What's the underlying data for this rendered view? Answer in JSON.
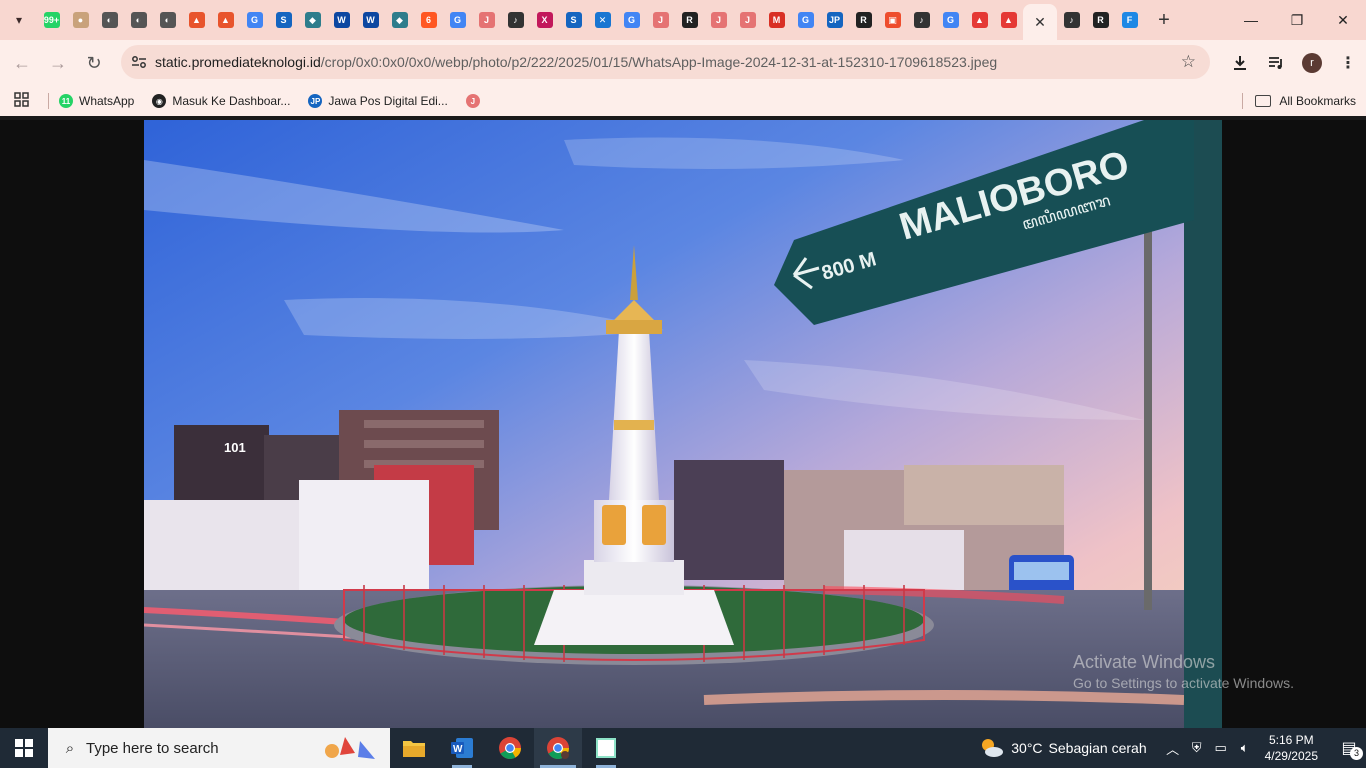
{
  "browser": {
    "tabs": [
      {
        "icon": "whatsapp-icon",
        "color": "#25d366",
        "glyph": "99+"
      },
      {
        "icon": "site-icon",
        "color": "#c9a27b",
        "glyph": "●"
      },
      {
        "icon": "globe-icon",
        "color": "#555555",
        "glyph": "◐"
      },
      {
        "icon": "globe-icon",
        "color": "#555555",
        "glyph": "◐"
      },
      {
        "icon": "globe-icon",
        "color": "#555555",
        "glyph": "◐"
      },
      {
        "icon": "fire-icon",
        "color": "#e8542c",
        "glyph": "▲"
      },
      {
        "icon": "fire-icon",
        "color": "#e8542c",
        "glyph": "▲"
      },
      {
        "icon": "google-icon",
        "color": "#4285f4",
        "glyph": "G"
      },
      {
        "icon": "site-icon",
        "color": "#1565c0",
        "glyph": "S"
      },
      {
        "icon": "shield-icon",
        "color": "#2e7d8c",
        "glyph": "◆"
      },
      {
        "icon": "site-icon",
        "color": "#0d47a1",
        "glyph": "W"
      },
      {
        "icon": "site-icon",
        "color": "#0d47a1",
        "glyph": "W"
      },
      {
        "icon": "shield-icon",
        "color": "#2e7d8c",
        "glyph": "◆"
      },
      {
        "icon": "site-icon",
        "color": "#ff5722",
        "glyph": "6"
      },
      {
        "icon": "google-icon",
        "color": "#4285f4",
        "glyph": "G"
      },
      {
        "icon": "jpr-icon",
        "color": "#e57373",
        "glyph": "J"
      },
      {
        "icon": "audio-icon",
        "color": "#333333",
        "glyph": "♪"
      },
      {
        "icon": "site-icon",
        "color": "#c2185b",
        "glyph": "X"
      },
      {
        "icon": "site-icon",
        "color": "#1565c0",
        "glyph": "S"
      },
      {
        "icon": "site-icon",
        "color": "#1976d2",
        "glyph": "✕"
      },
      {
        "icon": "google-icon",
        "color": "#4285f4",
        "glyph": "G"
      },
      {
        "icon": "jpr-icon",
        "color": "#e57373",
        "glyph": "J"
      },
      {
        "icon": "site-icon",
        "color": "#222222",
        "glyph": "R"
      },
      {
        "icon": "jpr-icon",
        "color": "#e57373",
        "glyph": "J"
      },
      {
        "icon": "jpr-icon",
        "color": "#e57373",
        "glyph": "J"
      },
      {
        "icon": "gmail-icon",
        "color": "#d93025",
        "glyph": "M"
      },
      {
        "icon": "google-icon",
        "color": "#4285f4",
        "glyph": "G"
      },
      {
        "icon": "jp-icon",
        "color": "#1565c0",
        "glyph": "JP"
      },
      {
        "icon": "site-icon",
        "color": "#222222",
        "glyph": "R"
      },
      {
        "icon": "shopping-icon",
        "color": "#ee4d2d",
        "glyph": "▣"
      },
      {
        "icon": "audio-icon",
        "color": "#333333",
        "glyph": "♪"
      },
      {
        "icon": "google-icon",
        "color": "#4285f4",
        "glyph": "G"
      },
      {
        "icon": "site-icon",
        "color": "#e53935",
        "glyph": "▲"
      },
      {
        "icon": "site-icon",
        "color": "#e53935",
        "glyph": "▲"
      }
    ],
    "after_tabs": [
      {
        "icon": "audio-icon",
        "color": "#333333",
        "glyph": "♪"
      },
      {
        "icon": "site-icon",
        "color": "#222222",
        "glyph": "R"
      },
      {
        "icon": "forms-icon",
        "color": "#1e88e5",
        "glyph": "F"
      }
    ],
    "url_host": "static.promediateknologi.id",
    "url_path": "/crop/0x0:0x0/0x0/webp/photo/p2/222/2025/01/15/WhatsApp-Image-2024-12-31-at-152310-1709618523.jpeg",
    "profile_initial": "r"
  },
  "bookmarks": {
    "items": [
      {
        "label": "WhatsApp",
        "icon": "whatsapp-icon",
        "color": "#25d366",
        "glyph": "11"
      },
      {
        "label": "Masuk Ke Dashboar...",
        "icon": "github-icon",
        "color": "#222222",
        "glyph": "◉"
      },
      {
        "label": "Jawa Pos Digital Edi...",
        "icon": "jp-icon",
        "color": "#1565c0",
        "glyph": "JP"
      },
      {
        "label": "",
        "icon": "jpr-icon",
        "color": "#e57373",
        "glyph": "J"
      }
    ],
    "all_label": "All Bookmarks"
  },
  "photo": {
    "sign_main": "MALIOBORO",
    "sign_distance": "800 M",
    "sign_script": "ꦩꦭꦶꦪꦧꦫ",
    "hotel_text": "101"
  },
  "watermark": {
    "title": "Activate Windows",
    "subtitle": "Go to Settings to activate Windows."
  },
  "taskbar": {
    "search_placeholder": "Type here to search",
    "weather_temp": "30°C",
    "weather_text": "Sebagian cerah",
    "time": "5:16 PM",
    "date": "4/29/2025",
    "notification_count": "3"
  }
}
